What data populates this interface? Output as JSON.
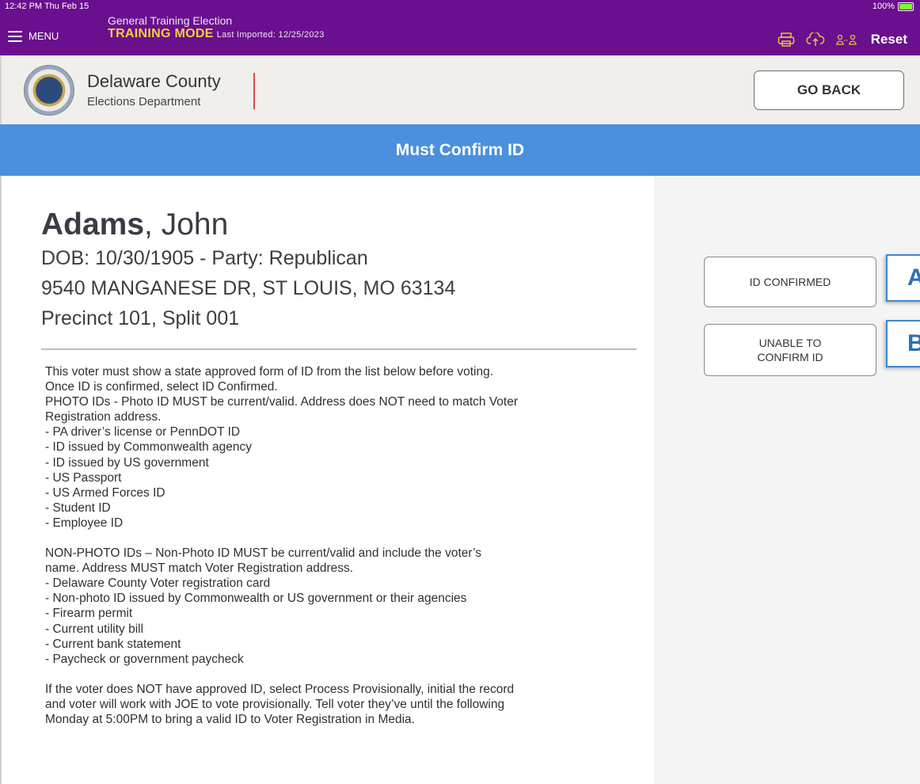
{
  "status_bar": {
    "time_date": "12:42 PM  Thu Feb 15",
    "battery": "100%"
  },
  "topbar": {
    "menu_label": "MENU",
    "election_name": "General Training Election",
    "mode": "TRAINING MODE",
    "last_imported": "Last Imported: 12/25/2023",
    "icons": [
      "printer-icon",
      "cloud-upload-icon",
      "users-sync-icon"
    ],
    "reset_label": "Reset"
  },
  "header": {
    "org_name": "Delaware County",
    "org_dept": "Elections Department",
    "go_back_label": "GO BACK"
  },
  "banner": {
    "title": "Must Confirm ID"
  },
  "voter": {
    "last_name": "Adams",
    "first_name": ", John",
    "dob_party": "DOB: 10/30/1905 - Party: Republican",
    "address": "9540 MANGANESE DR, ST LOUIS, MO 63134",
    "precinct": "Precinct 101, Split 001"
  },
  "instructions": {
    "photo_block": [
      "This voter must show a state approved form of ID from the list below before voting.",
      "Once ID is confirmed, select ID Confirmed.",
      "PHOTO IDs - Photo ID MUST be current/valid. Address does NOT need to match Voter",
      "Registration address.",
      "- PA driver’s license or PennDOT ID",
      "- ID issued by Commonwealth agency",
      "- ID issued by US government",
      "- US Passport",
      "- US Armed Forces ID",
      "- Student ID",
      "- Employee ID"
    ],
    "nonphoto_block": [
      "NON-PHOTO IDs – Non-Photo ID MUST be current/valid and include the voter’s",
      "name. Address MUST match Voter Registration address.",
      "- Delaware County Voter registration card",
      "- Non-photo ID issued by Commonwealth or US government or their agencies",
      "- Firearm permit",
      "- Current utility bill",
      "- Current bank statement",
      "- Paycheck or government paycheck"
    ],
    "provisional_block": [
      "If the voter does NOT have approved ID, select Process Provisionally, initial the record",
      "and voter will work with JOE to vote provisionally. Tell voter they’ve until the following",
      "Monday at 5:00PM to bring a valid ID to Voter Registration in Media."
    ]
  },
  "actions": {
    "id_confirmed": "ID CONFIRMED",
    "unable_line1": "UNABLE TO",
    "unable_line2": "CONFIRM ID"
  },
  "annotations": {
    "tag_a": "A",
    "tag_b": "B"
  },
  "colors": {
    "topbar": "#6a0f8e",
    "training_mode": "#f2cf3a",
    "banner": "#4a90dd",
    "annotation_border": "#3f86d1"
  }
}
